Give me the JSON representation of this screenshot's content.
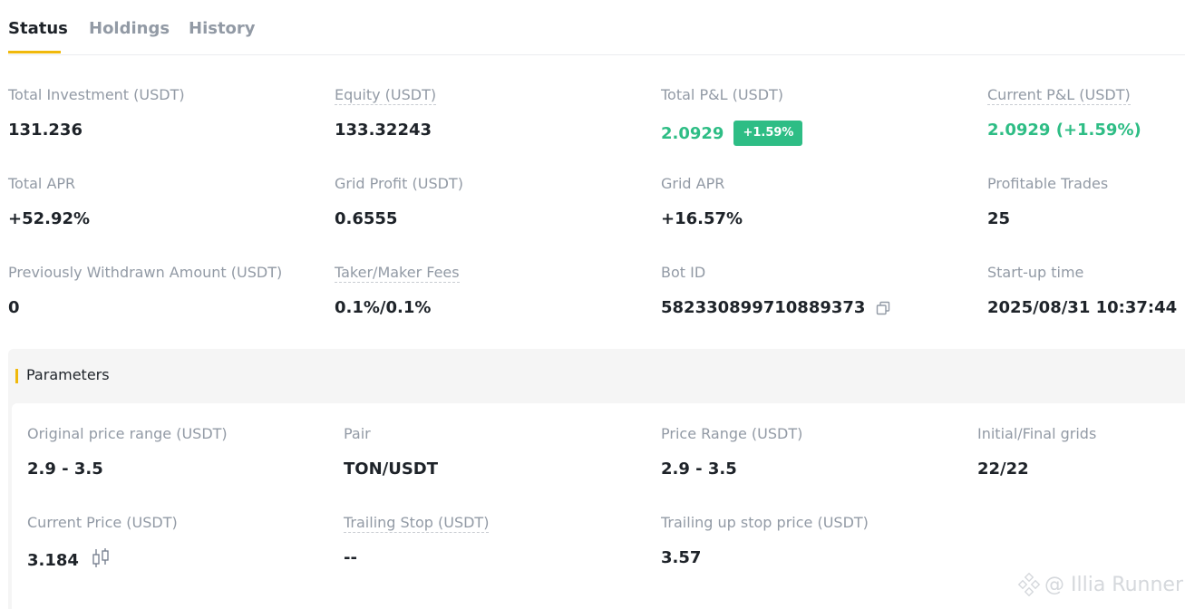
{
  "tabs": [
    {
      "label": "Status",
      "active": true
    },
    {
      "label": "Holdings",
      "active": false
    },
    {
      "label": "History",
      "active": false
    }
  ],
  "stats": {
    "total_investment": {
      "label": "Total Investment (USDT)",
      "value": "131.236"
    },
    "equity": {
      "label": "Equity (USDT)",
      "value": "133.32243"
    },
    "total_pnl": {
      "label": "Total P&L (USDT)",
      "value": "2.0929",
      "badge": "+1.59%"
    },
    "current_pnl": {
      "label": "Current P&L (USDT)",
      "value": "2.0929 (+1.59%)"
    },
    "total_apr": {
      "label": "Total APR",
      "value": "+52.92%"
    },
    "grid_profit": {
      "label": "Grid Profit (USDT)",
      "value": "0.6555"
    },
    "grid_apr": {
      "label": "Grid APR",
      "value": "+16.57%"
    },
    "profitable_trades": {
      "label": "Profitable Trades",
      "value": "25"
    },
    "withdrawn": {
      "label": "Previously Withdrawn Amount (USDT)",
      "value": "0"
    },
    "fees": {
      "label": "Taker/Maker Fees",
      "value": "0.1%/0.1%"
    },
    "bot_id": {
      "label": "Bot ID",
      "value": "582330899710889373"
    },
    "startup_time": {
      "label": "Start-up time",
      "value": "2025/08/31 10:37:44"
    }
  },
  "parameters": {
    "title": "Parameters",
    "original_range": {
      "label": "Original price range (USDT)",
      "value": "2.9 - 3.5"
    },
    "pair": {
      "label": "Pair",
      "value": "TON/USDT"
    },
    "price_range": {
      "label": "Price Range (USDT)",
      "value": "2.9 - 3.5"
    },
    "grids": {
      "label": "Initial/Final grids",
      "value": "22/22"
    },
    "current_price": {
      "label": "Current Price (USDT)",
      "value": "3.184"
    },
    "trailing_stop": {
      "label": "Trailing Stop (USDT)",
      "value": "--"
    },
    "trailing_up_stop": {
      "label": "Trailing up stop price (USDT)",
      "value": "3.57"
    }
  },
  "watermark": "@ Illia Runner",
  "colors": {
    "accent": "#f0b90b",
    "positive": "#2ebd85",
    "label": "#929aa5",
    "text": "#1e2329"
  },
  "icons": [
    "copy-icon",
    "candlestick-chart-icon",
    "binance-logo-icon"
  ]
}
